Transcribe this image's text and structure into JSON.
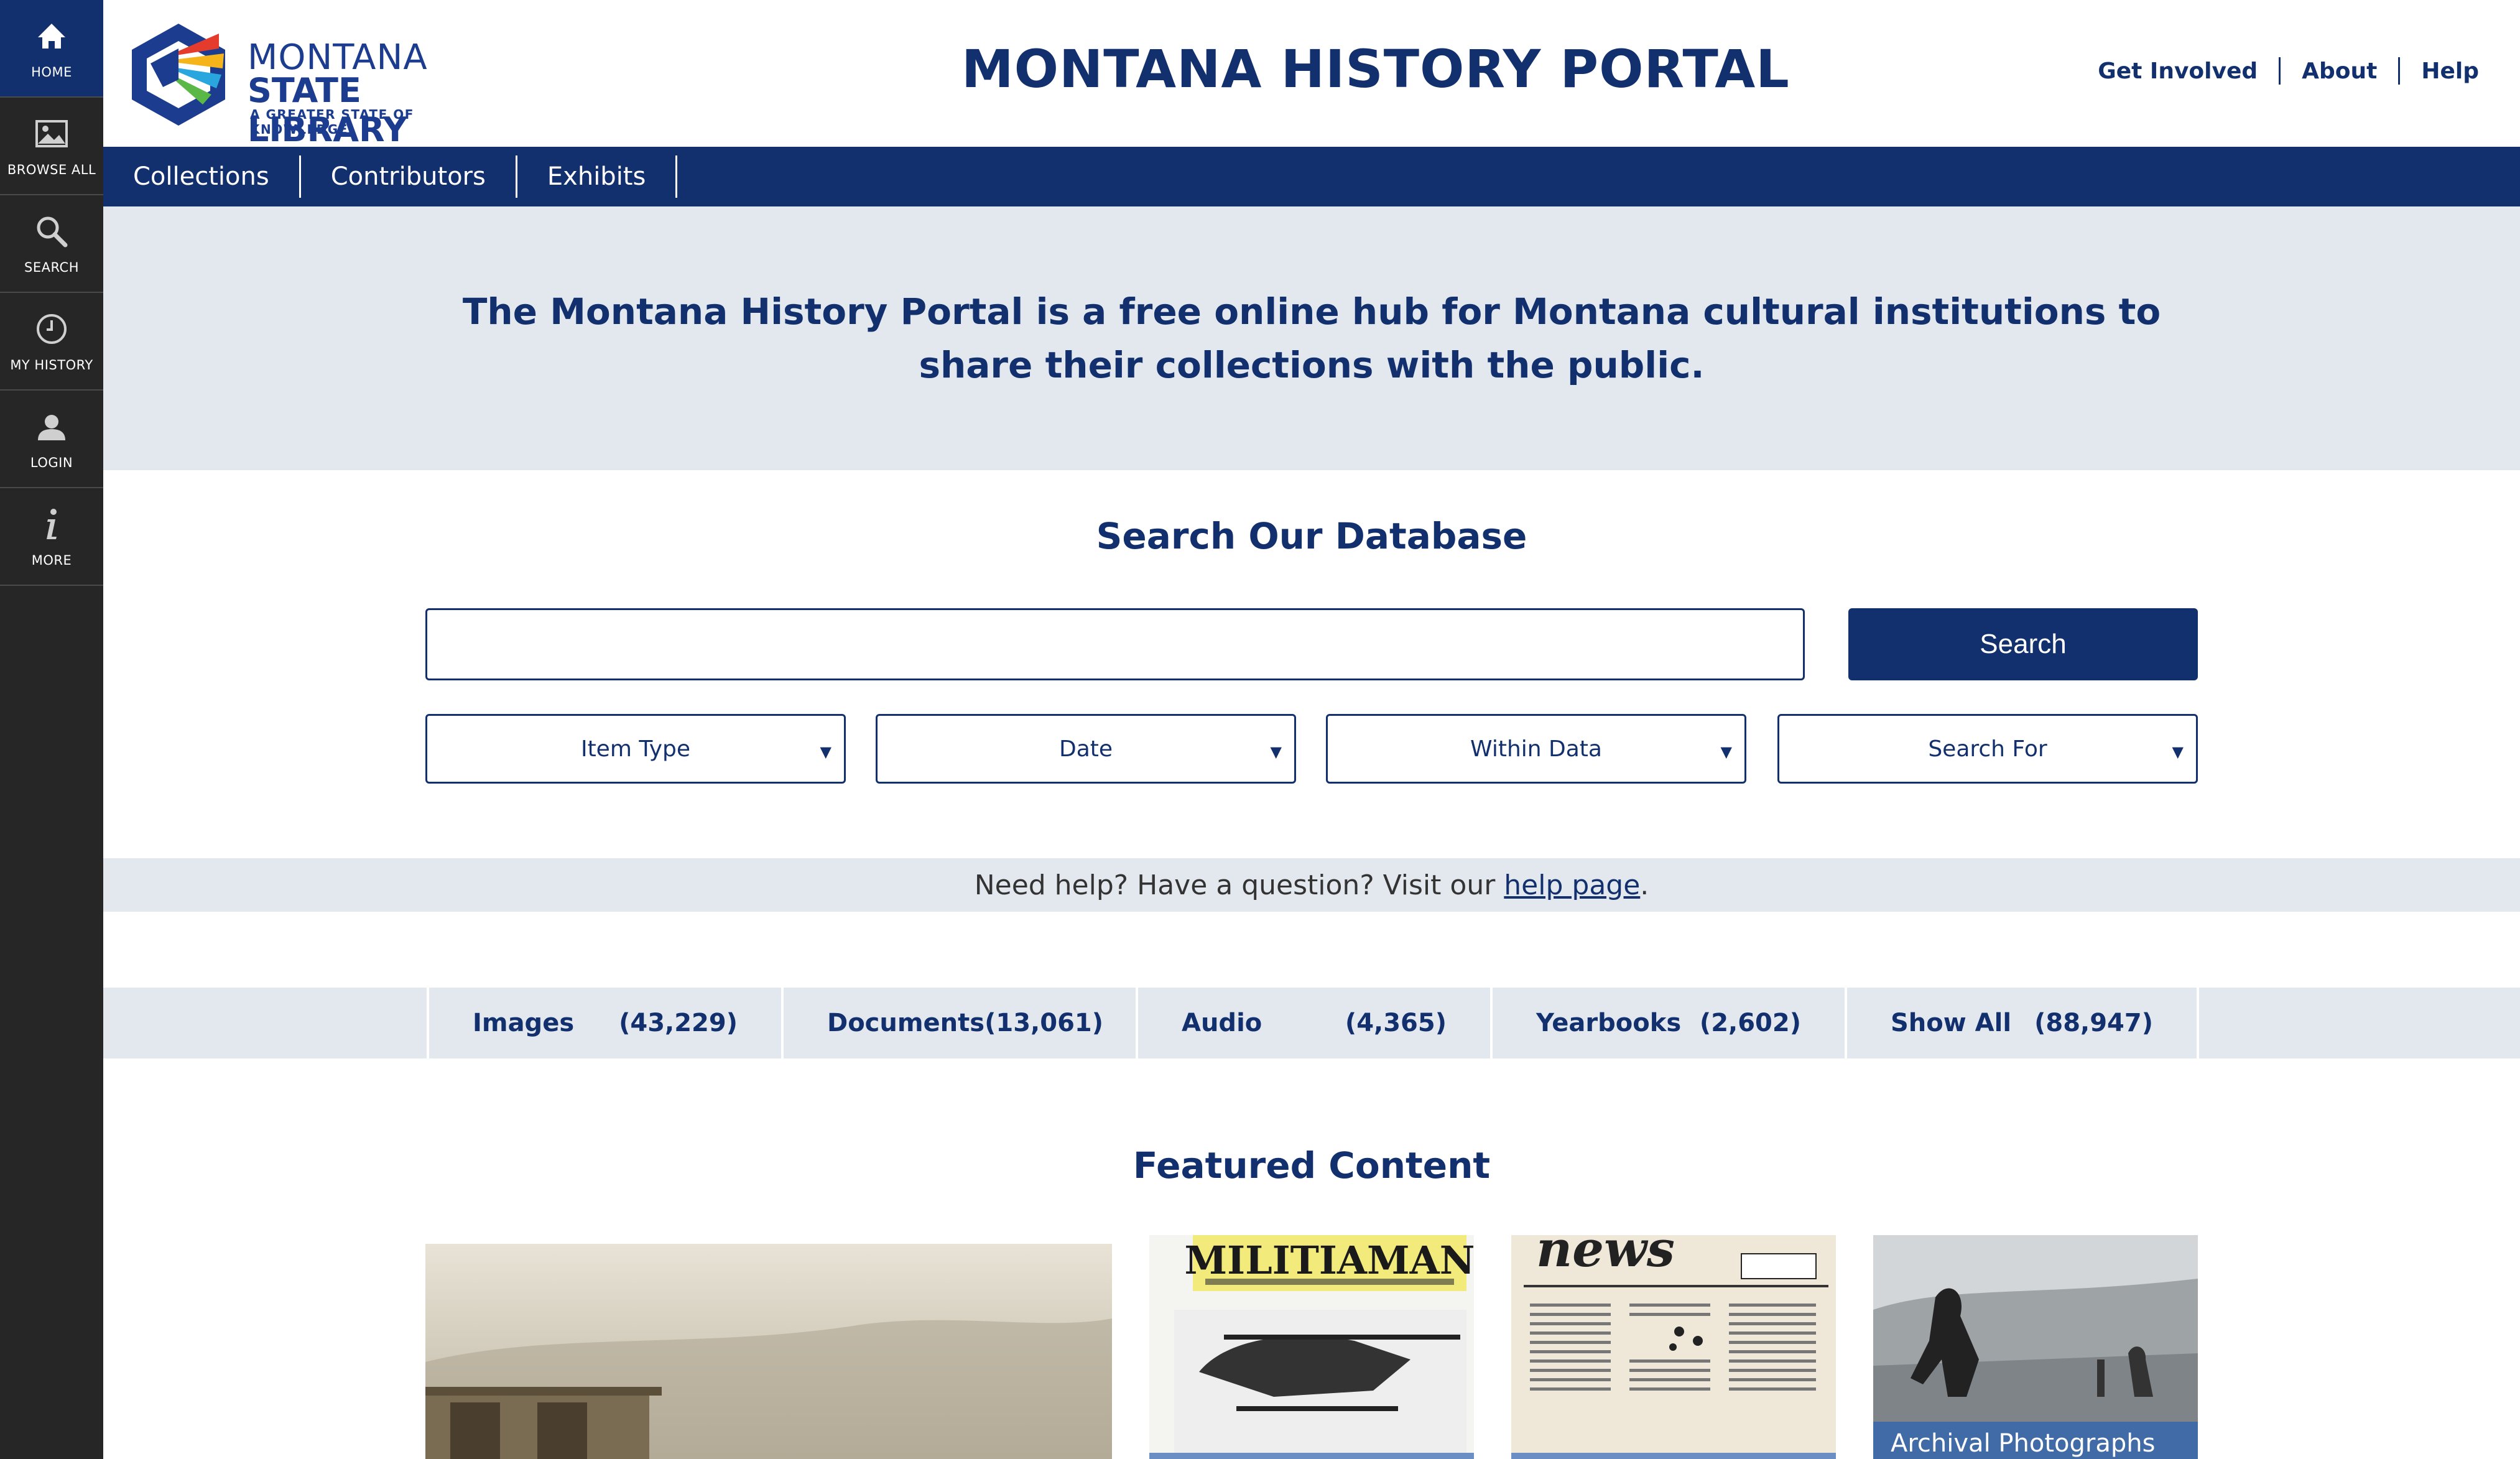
{
  "sidebar": {
    "items": [
      {
        "label": "HOME",
        "icon": "home-icon"
      },
      {
        "label": "BROWSE ALL",
        "icon": "image-icon"
      },
      {
        "label": "SEARCH",
        "icon": "search-icon"
      },
      {
        "label": "MY HISTORY",
        "icon": "clock-icon"
      },
      {
        "label": "LOGIN",
        "icon": "user-icon"
      },
      {
        "label": "MORE",
        "icon": "info-icon"
      }
    ]
  },
  "logo": {
    "line1": "MONTANA",
    "line2": "STATE LIBRARY",
    "tagline": "A GREATER STATE OF KNOWLEDGE"
  },
  "header": {
    "title": "MONTANA HISTORY PORTAL",
    "links": [
      "Get Involved",
      "About",
      "Help"
    ]
  },
  "nav": {
    "items": [
      "Collections",
      "Contributors",
      "Exhibits"
    ]
  },
  "hero": {
    "text": "The Montana History Portal is a free online hub for Montana cultural institutions to share their collections with the public."
  },
  "search": {
    "title": "Search Our Database",
    "placeholder": "",
    "button_label": "Search",
    "filters": [
      "Item Type",
      "Date",
      "Within Data",
      "Search For"
    ]
  },
  "help": {
    "text": "Need help? Have a question? Visit our",
    "link_label": "help page",
    "suffix": "."
  },
  "counts": [
    {
      "label": "Images",
      "count": "(43,229)"
    },
    {
      "label": "Documents",
      "count": "(13,061)"
    },
    {
      "label": "Audio",
      "count": "(4,365)"
    },
    {
      "label": "Yearbooks",
      "count": "(2,602)"
    },
    {
      "label": "Show All",
      "count": "(88,947)"
    }
  ],
  "featured": {
    "title": "Featured Content",
    "items": [
      {
        "caption": ""
      },
      {
        "masthead": "MILITIAMAN",
        "caption": ""
      },
      {
        "masthead": "news",
        "caption": ""
      },
      {
        "caption": "Archival Photographs"
      }
    ]
  },
  "colors": {
    "navy": "#13306e",
    "sidebar": "#262626",
    "light_band": "#e3e7ee"
  }
}
